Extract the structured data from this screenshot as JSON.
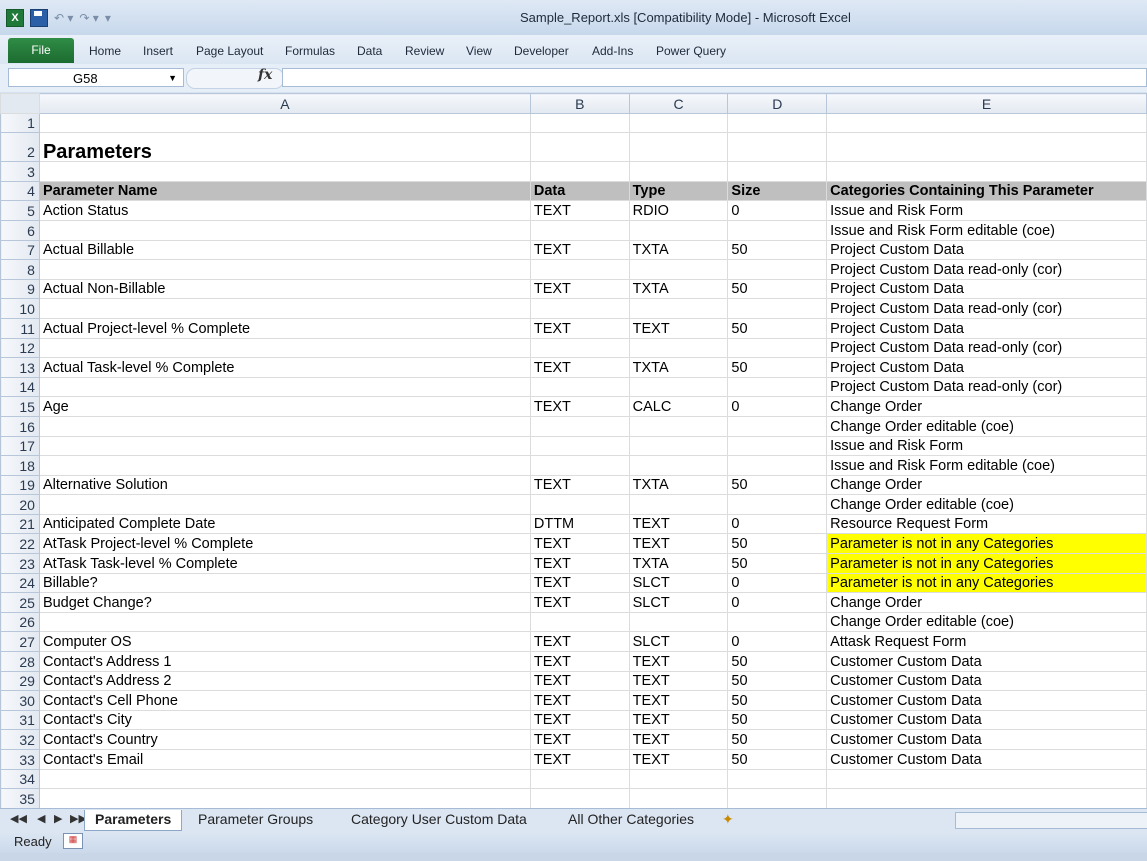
{
  "window": {
    "title": "Sample_Report.xls  [Compatibility Mode]  -  Microsoft Excel",
    "excel_icon_label": "X"
  },
  "quick_access": {
    "undo_glyph": "↶ ▾",
    "redo_glyph": "↷ ▾",
    "customize_glyph": "▾"
  },
  "ribbon": {
    "file_label": "File",
    "tabs": [
      "Home",
      "Insert",
      "Page Layout",
      "Formulas",
      "Data",
      "Review",
      "View",
      "Developer",
      "Add-Ins",
      "Power Query"
    ]
  },
  "formula_bar": {
    "name_box": "G58",
    "fx_label": "fx",
    "formula": ""
  },
  "columns": [
    "A",
    "B",
    "C",
    "D",
    "E"
  ],
  "rows": [
    {
      "n": "1",
      "a": "",
      "b": "",
      "c": "",
      "d": "",
      "e": ""
    },
    {
      "n": "2",
      "a": "Parameters",
      "b": "",
      "c": "",
      "d": "",
      "e": ""
    },
    {
      "n": "3",
      "a": "",
      "b": "",
      "c": "",
      "d": "",
      "e": ""
    },
    {
      "n": "4",
      "a": "Parameter Name",
      "b": "Data",
      "c": "Type",
      "d": "Size",
      "e": "Categories Containing This Parameter"
    },
    {
      "n": "5",
      "a": "Action Status",
      "b": "TEXT",
      "c": "RDIO",
      "d": "0",
      "e": "Issue and Risk Form"
    },
    {
      "n": "6",
      "a": "",
      "b": "",
      "c": "",
      "d": "",
      "e": "Issue and Risk Form editable (coe)"
    },
    {
      "n": "7",
      "a": "Actual Billable",
      "b": "TEXT",
      "c": "TXTA",
      "d": "50",
      "e": "Project Custom Data"
    },
    {
      "n": "8",
      "a": "",
      "b": "",
      "c": "",
      "d": "",
      "e": "Project Custom Data read-only (cor)"
    },
    {
      "n": "9",
      "a": "Actual Non-Billable",
      "b": "TEXT",
      "c": "TXTA",
      "d": "50",
      "e": "Project Custom Data"
    },
    {
      "n": "10",
      "a": "",
      "b": "",
      "c": "",
      "d": "",
      "e": "Project Custom Data read-only (cor)"
    },
    {
      "n": "11",
      "a": "Actual Project-level % Complete",
      "b": "TEXT",
      "c": "TEXT",
      "d": "50",
      "e": "Project Custom Data"
    },
    {
      "n": "12",
      "a": "",
      "b": "",
      "c": "",
      "d": "",
      "e": "Project Custom Data read-only (cor)"
    },
    {
      "n": "13",
      "a": "Actual Task-level % Complete",
      "b": "TEXT",
      "c": "TXTA",
      "d": "50",
      "e": "Project Custom Data"
    },
    {
      "n": "14",
      "a": "",
      "b": "",
      "c": "",
      "d": "",
      "e": "Project Custom Data read-only (cor)"
    },
    {
      "n": "15",
      "a": "Age",
      "b": "TEXT",
      "c": "CALC",
      "d": "0",
      "e": "Change Order"
    },
    {
      "n": "16",
      "a": "",
      "b": "",
      "c": "",
      "d": "",
      "e": "Change Order editable (coe)"
    },
    {
      "n": "17",
      "a": "",
      "b": "",
      "c": "",
      "d": "",
      "e": "Issue and Risk Form"
    },
    {
      "n": "18",
      "a": "",
      "b": "",
      "c": "",
      "d": "",
      "e": "Issue and Risk Form editable (coe)"
    },
    {
      "n": "19",
      "a": "Alternative Solution",
      "b": "TEXT",
      "c": "TXTA",
      "d": "50",
      "e": "Change Order"
    },
    {
      "n": "20",
      "a": "",
      "b": "",
      "c": "",
      "d": "",
      "e": "Change Order editable (coe)"
    },
    {
      "n": "21",
      "a": "Anticipated Complete Date",
      "b": "DTTM",
      "c": "TEXT",
      "d": "0",
      "e": "Resource Request Form"
    },
    {
      "n": "22",
      "a": "AtTask Project-level % Complete",
      "b": "TEXT",
      "c": "TEXT",
      "d": "50",
      "e": "Parameter is not in any Categories",
      "hl": true
    },
    {
      "n": "23",
      "a": "AtTask Task-level % Complete",
      "b": "TEXT",
      "c": "TXTA",
      "d": "50",
      "e": "Parameter is not in any Categories",
      "hl": true
    },
    {
      "n": "24",
      "a": "Billable?",
      "b": "TEXT",
      "c": "SLCT",
      "d": "0",
      "e": "Parameter is not in any Categories",
      "hl": true
    },
    {
      "n": "25",
      "a": "Budget Change?",
      "b": "TEXT",
      "c": "SLCT",
      "d": "0",
      "e": "Change Order"
    },
    {
      "n": "26",
      "a": "",
      "b": "",
      "c": "",
      "d": "",
      "e": "Change Order editable (coe)"
    },
    {
      "n": "27",
      "a": "Computer OS",
      "b": "TEXT",
      "c": "SLCT",
      "d": "0",
      "e": "Attask Request Form"
    },
    {
      "n": "28",
      "a": "Contact's Address 1",
      "b": "TEXT",
      "c": "TEXT",
      "d": "50",
      "e": "Customer Custom Data"
    },
    {
      "n": "29",
      "a": "Contact's Address 2",
      "b": "TEXT",
      "c": "TEXT",
      "d": "50",
      "e": "Customer Custom Data"
    },
    {
      "n": "30",
      "a": "Contact's Cell Phone",
      "b": "TEXT",
      "c": "TEXT",
      "d": "50",
      "e": "Customer Custom Data"
    },
    {
      "n": "31",
      "a": "Contact's City",
      "b": "TEXT",
      "c": "TEXT",
      "d": "50",
      "e": "Customer Custom Data"
    },
    {
      "n": "32",
      "a": "Contact's Country",
      "b": "TEXT",
      "c": "TEXT",
      "d": "50",
      "e": "Customer Custom Data"
    },
    {
      "n": "33",
      "a": "Contact's Email",
      "b": "TEXT",
      "c": "TEXT",
      "d": "50",
      "e": "Customer Custom Data"
    },
    {
      "n": "34",
      "a": "",
      "b": "",
      "c": "",
      "d": "",
      "e": ""
    },
    {
      "n": "35",
      "a": "",
      "b": "",
      "c": "",
      "d": "",
      "e": ""
    }
  ],
  "highlight_color": "#ffff00",
  "header_row_color": "#bfbfbf",
  "sheet_nav": [
    "◀◀",
    "◀",
    "▶",
    "▶▶"
  ],
  "sheets": [
    "Parameters",
    "Parameter Groups",
    "Category User Custom Data",
    "All Other Categories"
  ],
  "active_sheet": "Parameters",
  "status": {
    "ready": "Ready"
  }
}
